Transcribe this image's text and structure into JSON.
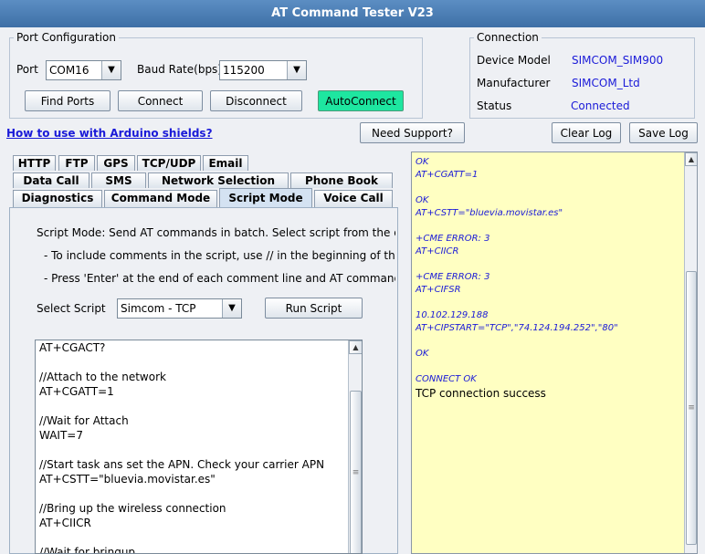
{
  "window": {
    "title": "AT Command Tester V23"
  },
  "port_config": {
    "title": "Port Configuration",
    "port_label": "Port",
    "port_value": "COM16",
    "baud_label": "Baud Rate(bps)",
    "baud_value": "115200",
    "buttons": {
      "find_ports": "Find Ports",
      "connect": "Connect",
      "disconnect": "Disconnect",
      "autoconnect": "AutoConnect"
    },
    "autoconnect_color": "#1ee6a0"
  },
  "connection": {
    "title": "Connection",
    "device_model_label": "Device Model",
    "device_model_value": "SIMCOM_SIM900",
    "manufacturer_label": "Manufacturer",
    "manufacturer_value": "SIMCOM_Ltd",
    "status_label": "Status",
    "status_value": "Connected"
  },
  "links": {
    "arduino": "How to use with Arduino shields?"
  },
  "toolbar": {
    "need_support": "Need Support?",
    "clear_log": "Clear Log",
    "save_log": "Save Log"
  },
  "tabs": {
    "row1": [
      "HTTP",
      "FTP",
      "GPS",
      "TCP/UDP",
      "Email"
    ],
    "row2": [
      "Data Call",
      "SMS",
      "Network Selection",
      "Phone Book"
    ],
    "row3": [
      "Diagnostics",
      "Command Mode",
      "Script Mode",
      "Voice Call"
    ],
    "selected": "Script Mode"
  },
  "script_mode": {
    "description": "Script Mode: Send AT commands in batch. Select script from the drop",
    "tip1": "- To include comments in the script, use // in the beginning of the line",
    "tip2": "- Press 'Enter' at the end of each comment line and AT command line",
    "select_label": "Select Script",
    "select_value": "Simcom - TCP",
    "run_button": "Run Script",
    "script_lines": [
      "AT+CGACT?",
      "",
      "//Attach to the network",
      "AT+CGATT=1",
      "",
      "//Wait for Attach",
      "WAIT=7",
      "",
      "//Start task ans set the APN. Check your carrier APN",
      "AT+CSTT=\"bluevia.movistar.es\"",
      "",
      "//Bring up the wireless connection",
      "AT+CIICR",
      "",
      "//Wait for bringup"
    ]
  },
  "log": {
    "lines": [
      "OK",
      "AT+CGATT=1",
      "",
      "OK",
      "AT+CSTT=\"bluevia.movistar.es\"",
      "",
      "+CME ERROR: 3",
      "AT+CIICR",
      "",
      "+CME ERROR: 3",
      "AT+CIFSR",
      "",
      "10.102.129.188",
      "AT+CIPSTART=\"TCP\",\"74.124.194.252\",\"80\"",
      "",
      "OK",
      "",
      "CONNECT OK"
    ],
    "final_line": "TCP connection success",
    "background_color": "#ffffc2"
  }
}
